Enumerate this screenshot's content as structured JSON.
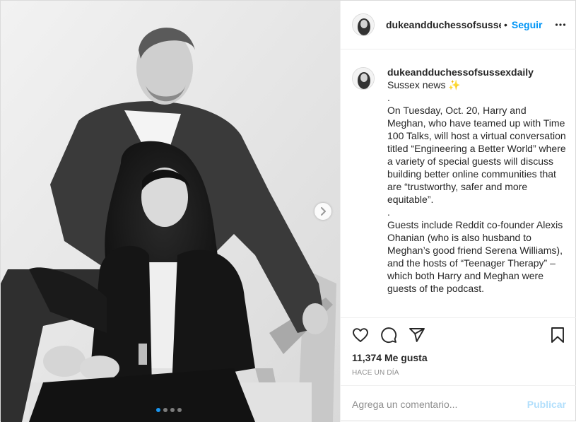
{
  "post": {
    "account": "dukeandduchessofsussexdaily",
    "separator": "•",
    "follow_label": "Seguir",
    "more_icon": "more-options-icon"
  },
  "caption": {
    "username": "dukeandduchessofsussexdaily",
    "title": "Sussex news",
    "sparkle": "✨",
    "dot1": ".",
    "paragraph1": "On Tuesday, Oct. 20, Harry and Meghan, who have teamed up with Time 100 Talks, will host a virtual conversation titled “Engineering a Better World” where a variety of special guests will discuss building better online communities that are “trustworthy, safer and more equitable”.",
    "dot2": ".",
    "paragraph2": "Guests include Reddit co-founder Alexis Ohanian (who is also husband to Meghan’s good friend Serena Williams), and the hosts of “Teenager Therapy” – which both Harry and Meghan were guests of the podcast."
  },
  "media": {
    "carousel_index": 1,
    "carousel_count": 4,
    "active_dot_color": "#1a96f0"
  },
  "actions": {
    "like_icon": "heart-icon",
    "comment_icon": "comment-icon",
    "share_icon": "share-icon",
    "save_icon": "bookmark-icon"
  },
  "stats": {
    "likes": "11,374 Me gusta",
    "time": "HACE UN DÍA"
  },
  "comment": {
    "placeholder": "Agrega un comentario...",
    "publish_label": "Publicar"
  },
  "colors": {
    "link": "#0095f6",
    "publish_disabled": "#b2dffc",
    "border": "#efefef",
    "muted": "#8e8e8e"
  }
}
